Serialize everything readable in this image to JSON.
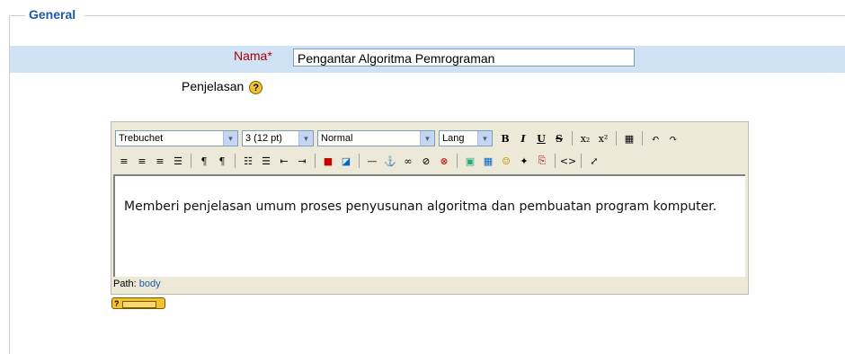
{
  "fieldset": {
    "legend": "General"
  },
  "name_field": {
    "label": "Nama",
    "required_mark": "*",
    "value": "Pengantar Algoritma Pemrograman"
  },
  "description_field": {
    "label": "Penjelasan",
    "help_glyph": "?"
  },
  "editor": {
    "font_select": "Trebuchet",
    "size_select": "3 (12 pt)",
    "format_select": "Normal",
    "lang_select": "Lang",
    "content": "Memberi penjelasan umum proses penyusunan algoritma dan pembuatan program komputer.",
    "path_label": "Path:",
    "path_value": "body"
  },
  "keyboard_help": {
    "glyph": "?"
  },
  "colors": {
    "legend": "#1f5aa8",
    "row_highlight": "#cfe2f6",
    "required": "#aa0000",
    "toolbar_bg": "#ece9d8"
  }
}
